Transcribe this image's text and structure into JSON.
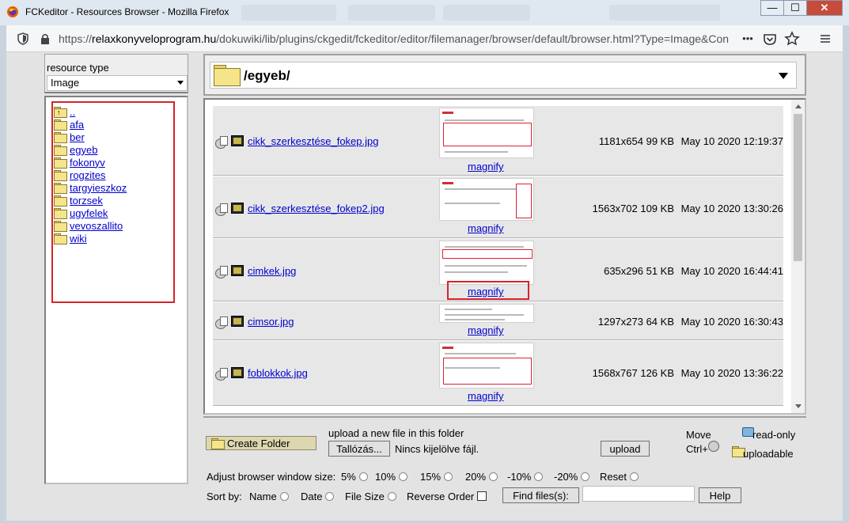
{
  "window": {
    "title": "FCKeditor - Resources Browser - Mozilla Firefox",
    "minimize": "—",
    "maximize": "☐",
    "close": "✕"
  },
  "toolbar": {
    "url_prefix": "https://",
    "url_host": "relaxkonyveloprogram.hu",
    "url_path": "/dokuwiki/lib/plugins/ckgedit/fckeditor/editor/filemanager/browser/default/browser.html?Type=Image&Con",
    "more_label": "•••"
  },
  "resource": {
    "label": "resource type",
    "selected": "Image"
  },
  "tree": {
    "up_label": "..",
    "folders": [
      "afa",
      "ber",
      "egyeb",
      "fokonyv",
      "rogzites",
      "targyieszkoz",
      "torzsek",
      "ugyfelek",
      "vevoszallito",
      "wiki"
    ]
  },
  "current_path": "/egyeb/",
  "files": [
    {
      "name": "cikk_szerkesztése_fokep.jpg",
      "dims": "1181x654 99 KB",
      "date": "May 10 2020 12:19:37",
      "magnify": "magnify"
    },
    {
      "name": "cikk_szerkesztése_fokep2.jpg",
      "dims": "1563x702 109 KB",
      "date": "May 10 2020 13:30:26",
      "magnify": "magnify"
    },
    {
      "name": "cimkek.jpg",
      "dims": "635x296 51 KB",
      "date": "May 10 2020 16:44:41",
      "magnify": "magnify"
    },
    {
      "name": "cimsor.jpg",
      "dims": "1297x273 64 KB",
      "date": "May 10 2020 16:30:43",
      "magnify": "magnify"
    },
    {
      "name": "foblokkok.jpg",
      "dims": "1568x767 126 KB",
      "date": "May 10 2020 13:36:22",
      "magnify": "magnify"
    }
  ],
  "bottom": {
    "create_folder": "Create Folder",
    "upload_label": "upload a new file in this folder",
    "browse_button": "Tallózás...",
    "no_file": "Nincs kijelölve fájl.",
    "upload_button": "upload",
    "move_label": "Move",
    "ctrl_label": "Ctrl+",
    "readonly_label": "read-only",
    "uploadable_label": "uploadable"
  },
  "adjust": {
    "label": "Adjust browser window size:",
    "options": [
      "5%",
      "10%",
      "15%",
      "20%",
      "-10%",
      "-20%",
      "Reset"
    ]
  },
  "sort": {
    "label": "Sort by:",
    "options": [
      "Name",
      "Date",
      "File Size"
    ],
    "reverse_label": "Reverse Order",
    "find_button": "Find files(s):",
    "help_button": "Help"
  }
}
